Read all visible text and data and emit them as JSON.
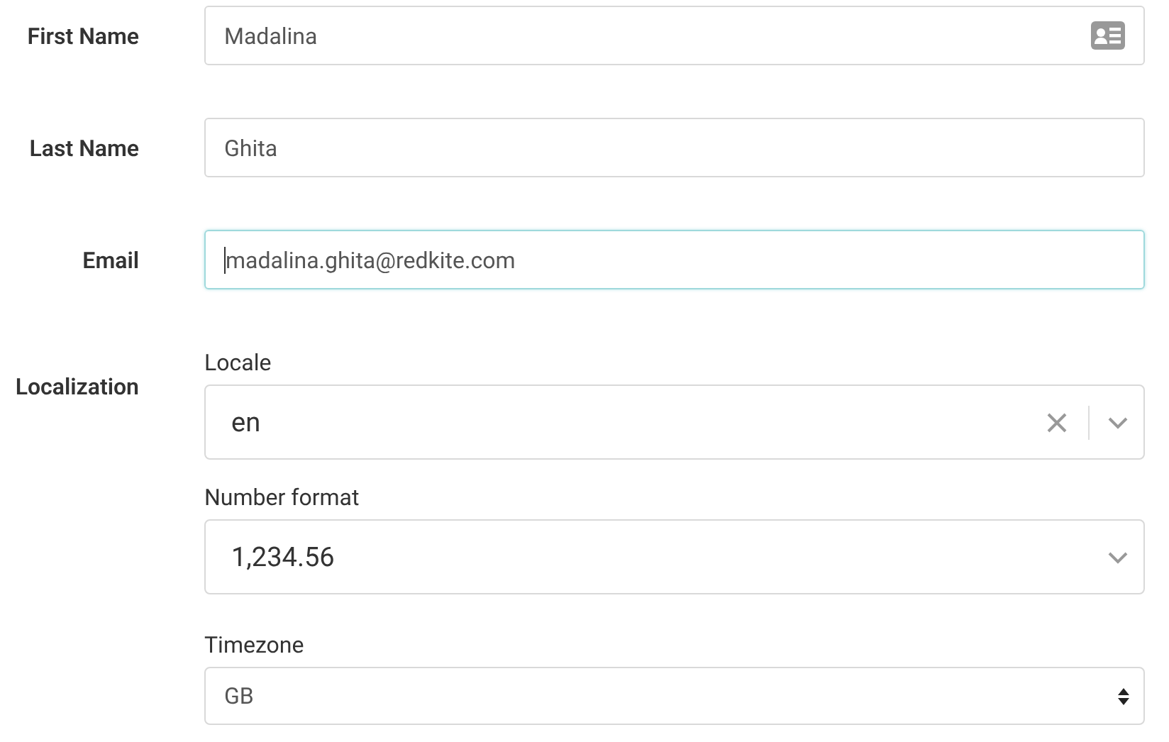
{
  "fields": [
    {
      "kind": "contact",
      "label": "First Name",
      "value": "Madalina",
      "focused": false
    },
    {
      "kind": "text",
      "label": "Last Name",
      "value": "Ghita",
      "focused": false
    },
    {
      "kind": "text",
      "label": "Email",
      "value": "madalina.ghita@redkite.com",
      "focused": true
    }
  ],
  "localization": {
    "label": "Localization",
    "settings": [
      {
        "kind": "combo",
        "label": "Locale",
        "value": "en"
      },
      {
        "kind": "select",
        "label": "Number format",
        "value": "1,234.56"
      },
      {
        "kind": "native",
        "label": "Timezone",
        "value": "GB"
      }
    ]
  }
}
